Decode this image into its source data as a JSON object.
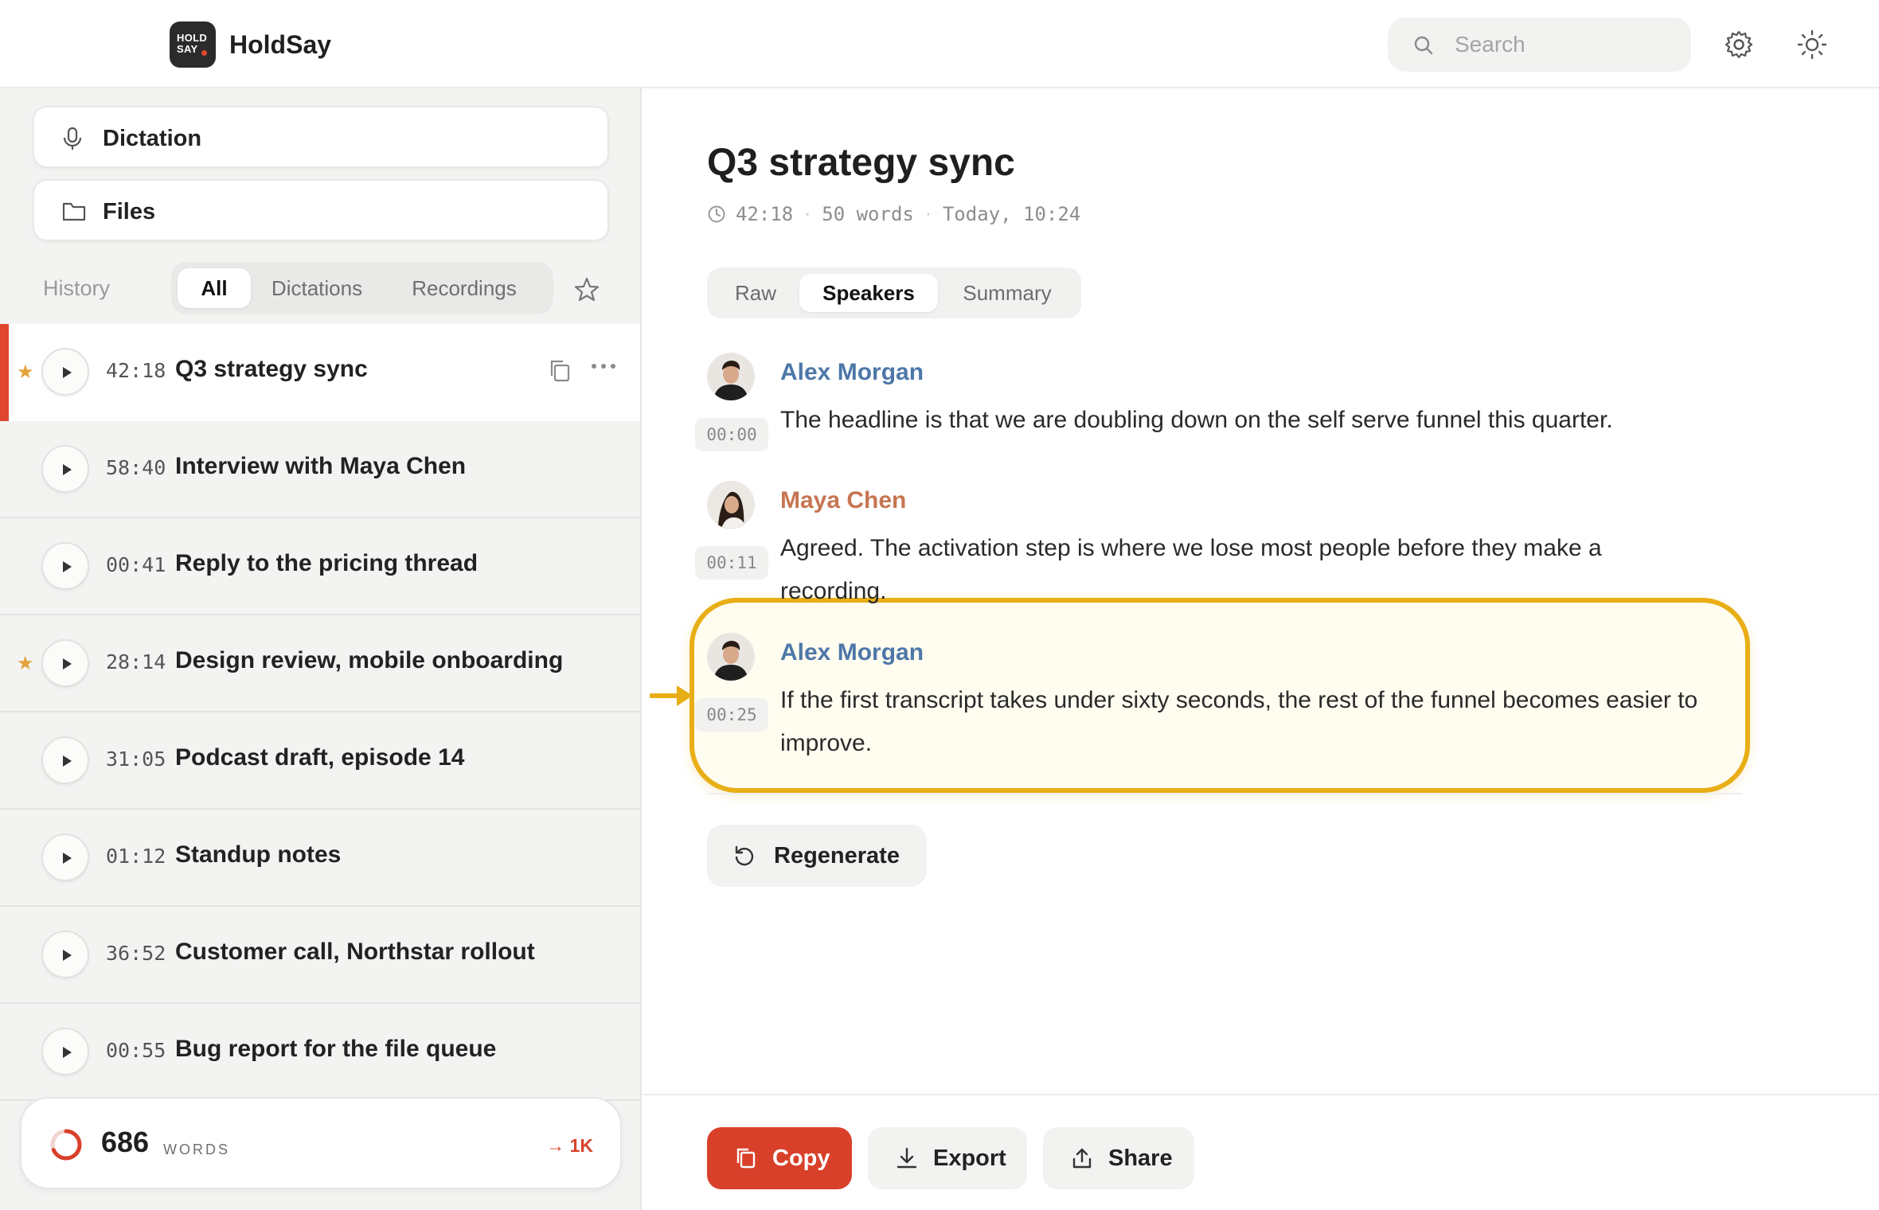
{
  "app": {
    "name": "HoldSay",
    "logo_line1": "HOLD",
    "logo_line2": "SAY"
  },
  "header": {
    "search_placeholder": "Search",
    "icons": [
      "search-icon",
      "gear-icon",
      "sun-icon"
    ]
  },
  "sidebar": {
    "nav": [
      {
        "label": "Dictation",
        "icon": "microphone-icon"
      },
      {
        "label": "Files",
        "icon": "folder-icon"
      }
    ],
    "history_label": "History",
    "filters": [
      "All",
      "Dictations",
      "Recordings"
    ],
    "active_filter": "All",
    "items": [
      {
        "duration": "42:18",
        "title": "Q3 strategy sync",
        "starred": true,
        "active": true
      },
      {
        "duration": "58:40",
        "title": "Interview with Maya Chen",
        "starred": false,
        "active": false
      },
      {
        "duration": "00:41",
        "title": "Reply to the pricing thread",
        "starred": false,
        "active": false
      },
      {
        "duration": "28:14",
        "title": "Design review, mobile onboarding",
        "starred": true,
        "active": false
      },
      {
        "duration": "31:05",
        "title": "Podcast draft, episode 14",
        "starred": false,
        "active": false
      },
      {
        "duration": "01:12",
        "title": "Standup notes",
        "starred": false,
        "active": false
      },
      {
        "duration": "36:52",
        "title": "Customer call, Northstar rollout",
        "starred": false,
        "active": false
      },
      {
        "duration": "00:55",
        "title": "Bug report for the file queue",
        "starred": false,
        "active": false
      }
    ],
    "word_count": {
      "value": "686",
      "label": "WORDS",
      "goal": "→ 1K",
      "progress_fraction": 0.686
    }
  },
  "document": {
    "title": "Q3 strategy sync",
    "duration": "42:18",
    "words": "50 words",
    "timestamp": "Today, 10:24",
    "tabs": [
      "Raw",
      "Speakers",
      "Summary"
    ],
    "active_tab": "Speakers",
    "segments": [
      {
        "speaker": "Alex Morgan",
        "time": "00:00",
        "text": "The headline is that we are doubling down on the self serve funnel this quarter.",
        "highlighted": false
      },
      {
        "speaker": "Maya Chen",
        "time": "00:11",
        "text": "Agreed. The activation step is where we lose most people before they make a recording.",
        "highlighted": false
      },
      {
        "speaker": "Alex Morgan",
        "time": "00:25",
        "text": "If the first transcript takes under sixty seconds, the rest of the funnel becomes easier to improve.",
        "highlighted": true
      }
    ],
    "regenerate_label": "Regenerate"
  },
  "actions": {
    "copy": "Copy",
    "export": "Export",
    "share": "Share"
  },
  "colors": {
    "accent": "#d9402a",
    "highlight": "#e8ae15",
    "star": "#e3a23a",
    "alex": "#4d77a8",
    "maya": "#c67552"
  }
}
